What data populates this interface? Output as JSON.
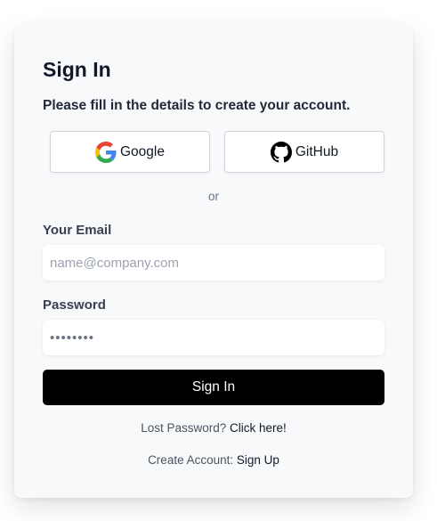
{
  "form": {
    "title": "Sign In",
    "subtitle": "Please fill in the details to create your account.",
    "social": {
      "google_label": "Google",
      "github_label": "GitHub"
    },
    "divider": "or",
    "email": {
      "label": "Your Email",
      "placeholder": "name@company.com",
      "value": ""
    },
    "password": {
      "label": "Password",
      "value": "••••••••"
    },
    "submit_label": "Sign In",
    "lost_password": {
      "prefix": "Lost Password?",
      "link": "Click here!"
    },
    "create_account": {
      "prefix": "Create Account:",
      "link": "Sign Up"
    }
  },
  "icons": {
    "google": "google-icon",
    "github": "github-icon"
  },
  "colors": {
    "card_background": "#f8f9fb",
    "primary_button": "#000000",
    "primary_button_text": "#ffffff",
    "google_blue": "#4285F4",
    "google_red": "#EA4335",
    "google_yellow": "#FBBC05",
    "google_green": "#34A853"
  }
}
